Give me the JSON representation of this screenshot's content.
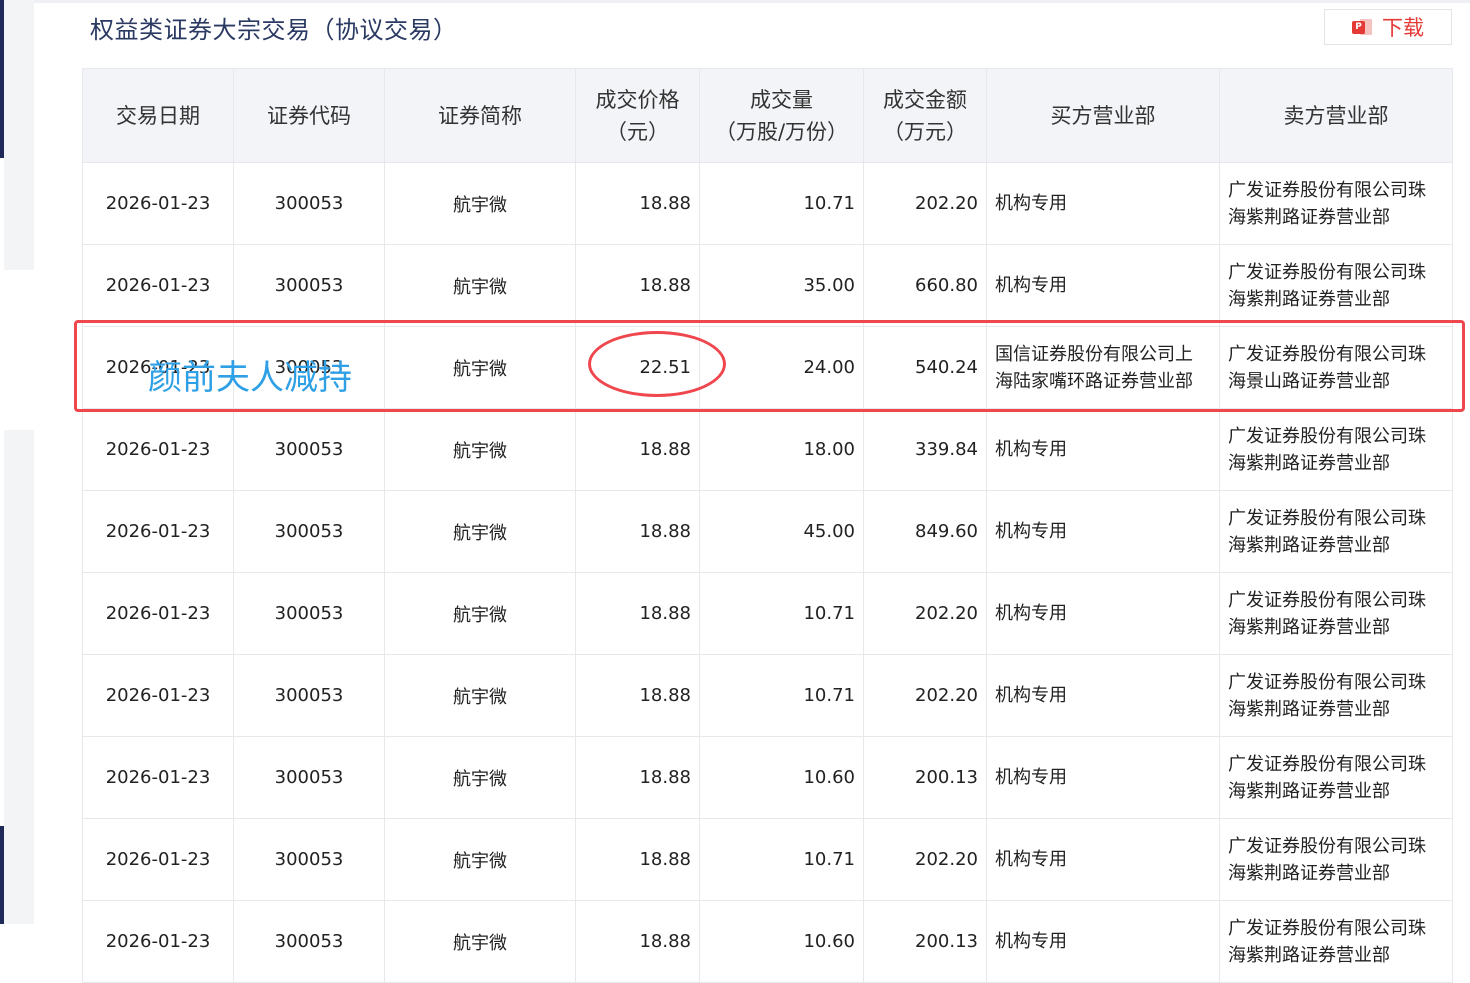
{
  "title": "权益类证券大宗交易（协议交易）",
  "download": {
    "label": "下载",
    "icon": "ppt-file-icon"
  },
  "table": {
    "headers": [
      [
        "交易日期"
      ],
      [
        "证券代码"
      ],
      [
        "证券简称"
      ],
      [
        "成交价格",
        "（元）"
      ],
      [
        "成交量",
        "（万股/万份）"
      ],
      [
        "成交金额",
        "（万元）"
      ],
      [
        "买方营业部"
      ],
      [
        "卖方营业部"
      ]
    ],
    "rows": [
      {
        "date": "2026-01-23",
        "code": "300053",
        "name": "航宇微",
        "price": "18.88",
        "volume": "10.71",
        "amount": "202.20",
        "buyer": [
          "机构专用"
        ],
        "seller": [
          "广发证券股份有限公司珠",
          "海紫荆路证券营业部"
        ]
      },
      {
        "date": "2026-01-23",
        "code": "300053",
        "name": "航宇微",
        "price": "18.88",
        "volume": "35.00",
        "amount": "660.80",
        "buyer": [
          "机构专用"
        ],
        "seller": [
          "广发证券股份有限公司珠",
          "海紫荆路证券营业部"
        ]
      },
      {
        "date": "2026-01-23",
        "code": "300053",
        "name": "航宇微",
        "price": "22.51",
        "volume": "24.00",
        "amount": "540.24",
        "buyer": [
          "国信证券股份有限公司上",
          "海陆家嘴环路证券营业部"
        ],
        "seller": [
          "广发证券股份有限公司珠",
          "海景山路证券营业部"
        ]
      },
      {
        "date": "2026-01-23",
        "code": "300053",
        "name": "航宇微",
        "price": "18.88",
        "volume": "18.00",
        "amount": "339.84",
        "buyer": [
          "机构专用"
        ],
        "seller": [
          "广发证券股份有限公司珠",
          "海紫荆路证券营业部"
        ]
      },
      {
        "date": "2026-01-23",
        "code": "300053",
        "name": "航宇微",
        "price": "18.88",
        "volume": "45.00",
        "amount": "849.60",
        "buyer": [
          "机构专用"
        ],
        "seller": [
          "广发证券股份有限公司珠",
          "海紫荆路证券营业部"
        ]
      },
      {
        "date": "2026-01-23",
        "code": "300053",
        "name": "航宇微",
        "price": "18.88",
        "volume": "10.71",
        "amount": "202.20",
        "buyer": [
          "机构专用"
        ],
        "seller": [
          "广发证券股份有限公司珠",
          "海紫荆路证券营业部"
        ]
      },
      {
        "date": "2026-01-23",
        "code": "300053",
        "name": "航宇微",
        "price": "18.88",
        "volume": "10.71",
        "amount": "202.20",
        "buyer": [
          "机构专用"
        ],
        "seller": [
          "广发证券股份有限公司珠",
          "海紫荆路证券营业部"
        ]
      },
      {
        "date": "2026-01-23",
        "code": "300053",
        "name": "航宇微",
        "price": "18.88",
        "volume": "10.60",
        "amount": "200.13",
        "buyer": [
          "机构专用"
        ],
        "seller": [
          "广发证券股份有限公司珠",
          "海紫荆路证券营业部"
        ]
      },
      {
        "date": "2026-01-23",
        "code": "300053",
        "name": "航宇微",
        "price": "18.88",
        "volume": "10.71",
        "amount": "202.20",
        "buyer": [
          "机构专用"
        ],
        "seller": [
          "广发证券股份有限公司珠",
          "海紫荆路证券营业部"
        ]
      },
      {
        "date": "2026-01-23",
        "code": "300053",
        "name": "航宇微",
        "price": "18.88",
        "volume": "10.60",
        "amount": "200.13",
        "buyer": [
          "机构专用"
        ],
        "seller": [
          "广发证券股份有限公司珠",
          "海紫荆路证券营业部"
        ]
      }
    ]
  },
  "annotation": {
    "text": "颜前夫人减持",
    "highlight_row": 2,
    "color_box": "#f0474f",
    "color_text": "#2fa0e6"
  },
  "colors": {
    "title": "#2b3a63",
    "download": "#e53935",
    "header_bg": "#f3f4f7"
  }
}
